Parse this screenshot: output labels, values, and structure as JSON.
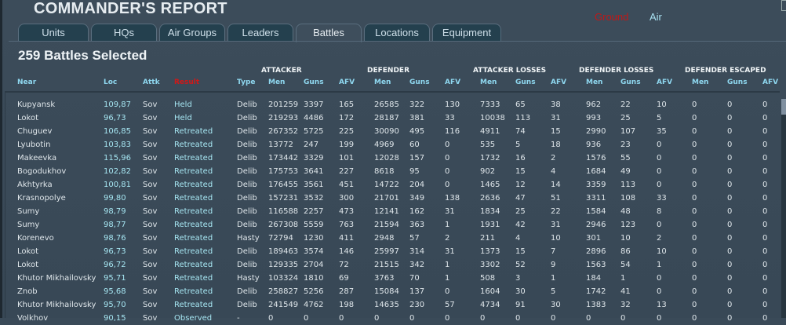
{
  "window": {
    "title": "COMMANDER'S REPORT"
  },
  "mode": {
    "ground": "Ground",
    "air": "Air",
    "ground_color": "#c01818"
  },
  "tabs": [
    "Units",
    "HQs",
    "Air Groups",
    "Leaders",
    "Battles",
    "Locations",
    "Equipment"
  ],
  "active_tab": "Battles",
  "summary": "259 Battles Selected",
  "groups": [
    "ATTACKER",
    "DEFENDER",
    "ATTACKER LOSSES",
    "DEFENDER LOSSES",
    "DEFENDER ESCAPED"
  ],
  "columns": [
    "Near",
    "Loc",
    "Attk",
    "Result",
    "Type",
    "Men",
    "Guns",
    "AFV",
    "Men",
    "Guns",
    "AFV",
    "Men",
    "Guns",
    "AFV",
    "Men",
    "Guns",
    "AFV",
    "Men",
    "Guns",
    "AFV"
  ],
  "sorted_column": "Result",
  "rows": [
    [
      "Kupyansk",
      "109,87",
      "Sov",
      "Held",
      "Delib",
      "201259",
      "3397",
      "165",
      "26585",
      "322",
      "130",
      "7333",
      "65",
      "38",
      "962",
      "22",
      "10",
      "0",
      "0",
      "0"
    ],
    [
      "Lokot",
      "96,73",
      "Sov",
      "Held",
      "Delib",
      "219293",
      "4486",
      "172",
      "28187",
      "381",
      "33",
      "10038",
      "113",
      "31",
      "993",
      "25",
      "5",
      "0",
      "0",
      "0"
    ],
    [
      "Chuguev",
      "106,85",
      "Sov",
      "Retreated",
      "Delib",
      "267352",
      "5725",
      "225",
      "30090",
      "495",
      "116",
      "4911",
      "74",
      "15",
      "2990",
      "107",
      "35",
      "0",
      "0",
      "0"
    ],
    [
      "Lyubotin",
      "103,83",
      "Sov",
      "Retreated",
      "Delib",
      "13772",
      "247",
      "199",
      "4969",
      "60",
      "0",
      "535",
      "5",
      "18",
      "936",
      "23",
      "0",
      "0",
      "0",
      "0"
    ],
    [
      "Makeevka",
      "115,96",
      "Sov",
      "Retreated",
      "Delib",
      "173442",
      "3329",
      "101",
      "12028",
      "157",
      "0",
      "1732",
      "16",
      "2",
      "1576",
      "55",
      "0",
      "0",
      "0",
      "0"
    ],
    [
      "Bogodukhov",
      "102,82",
      "Sov",
      "Retreated",
      "Delib",
      "175753",
      "3641",
      "227",
      "8618",
      "95",
      "0",
      "902",
      "15",
      "4",
      "1684",
      "49",
      "0",
      "0",
      "0",
      "0"
    ],
    [
      "Akhtyrka",
      "100,81",
      "Sov",
      "Retreated",
      "Delib",
      "176455",
      "3561",
      "451",
      "14722",
      "204",
      "0",
      "1465",
      "12",
      "14",
      "3359",
      "113",
      "0",
      "0",
      "0",
      "0"
    ],
    [
      "Krasnopolye",
      "99,80",
      "Sov",
      "Retreated",
      "Delib",
      "157231",
      "3532",
      "300",
      "21701",
      "349",
      "138",
      "2636",
      "47",
      "51",
      "3311",
      "108",
      "33",
      "0",
      "0",
      "0"
    ],
    [
      "Sumy",
      "98,79",
      "Sov",
      "Retreated",
      "Delib",
      "116588",
      "2257",
      "473",
      "12141",
      "162",
      "31",
      "1834",
      "25",
      "22",
      "1584",
      "48",
      "8",
      "0",
      "0",
      "0"
    ],
    [
      "Sumy",
      "98,77",
      "Sov",
      "Retreated",
      "Delib",
      "267308",
      "5559",
      "763",
      "21594",
      "363",
      "1",
      "1931",
      "42",
      "31",
      "2946",
      "123",
      "0",
      "0",
      "0",
      "0"
    ],
    [
      "Korenevo",
      "98,76",
      "Sov",
      "Retreated",
      "Hasty",
      "72794",
      "1230",
      "411",
      "2948",
      "57",
      "2",
      "211",
      "4",
      "10",
      "301",
      "10",
      "2",
      "0",
      "0",
      "0"
    ],
    [
      "Lokot",
      "96,73",
      "Sov",
      "Retreated",
      "Delib",
      "189463",
      "3574",
      "146",
      "25997",
      "314",
      "31",
      "1373",
      "15",
      "7",
      "2896",
      "86",
      "10",
      "0",
      "0",
      "0"
    ],
    [
      "Lokot",
      "96,72",
      "Sov",
      "Retreated",
      "Delib",
      "129335",
      "2704",
      "72",
      "21515",
      "342",
      "1",
      "3302",
      "52",
      "9",
      "1563",
      "54",
      "1",
      "0",
      "0",
      "0"
    ],
    [
      "Khutor Mikhailovsky",
      "95,71",
      "Sov",
      "Retreated",
      "Hasty",
      "103324",
      "1810",
      "69",
      "3763",
      "70",
      "1",
      "508",
      "3",
      "1",
      "184",
      "1",
      "0",
      "0",
      "0",
      "0"
    ],
    [
      "Znob",
      "95,68",
      "Sov",
      "Retreated",
      "Delib",
      "258827",
      "5256",
      "287",
      "15084",
      "137",
      "0",
      "1604",
      "30",
      "5",
      "1742",
      "41",
      "0",
      "0",
      "0",
      "0"
    ],
    [
      "Khutor Mikhailovsky",
      "95,70",
      "Sov",
      "Retreated",
      "Delib",
      "241549",
      "4762",
      "198",
      "14635",
      "230",
      "57",
      "4734",
      "91",
      "30",
      "1383",
      "32",
      "13",
      "0",
      "0",
      "0"
    ],
    [
      "Volkhov",
      "90,15",
      "Sov",
      "Observed",
      "-",
      "0",
      "0",
      "0",
      "0",
      "0",
      "0",
      "0",
      "0",
      "0",
      "0",
      "0",
      "0",
      "0",
      "0",
      "0"
    ]
  ]
}
